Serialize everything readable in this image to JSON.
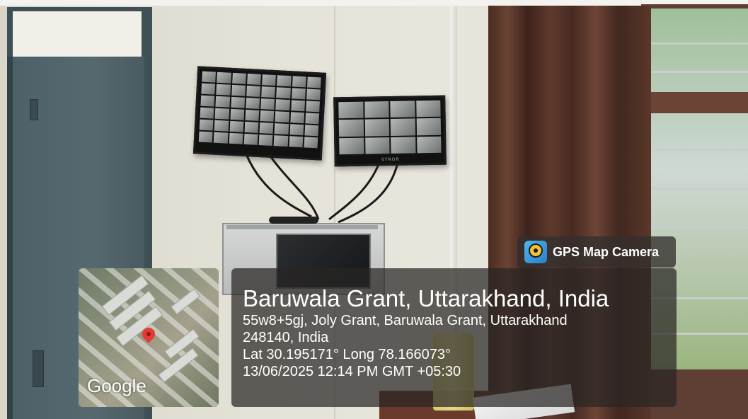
{
  "overlay": {
    "app_name": "GPS Map Camera",
    "place_title": "Baruwala Grant, Uttarakhand, India",
    "address_line1": "55w8+5gj, Joly Grant, Baruwala Grant, Uttarakhand",
    "address_line2": "248140, India",
    "coordinates": "Lat 30.195171° Long 78.166073°",
    "datetime": "13/06/2025 12:14 PM GMT +05:30",
    "map_brand": "Google"
  },
  "scene": {
    "monitor_brand": "SYNOR",
    "icons": [
      "map-pin-icon",
      "gps-camera-app-icon"
    ],
    "colors": {
      "wall": "#e6e4d9",
      "door": "#4d6068",
      "curtain": "#5a3729",
      "overlay_bg": "#282624",
      "pin": "#e53935"
    }
  }
}
